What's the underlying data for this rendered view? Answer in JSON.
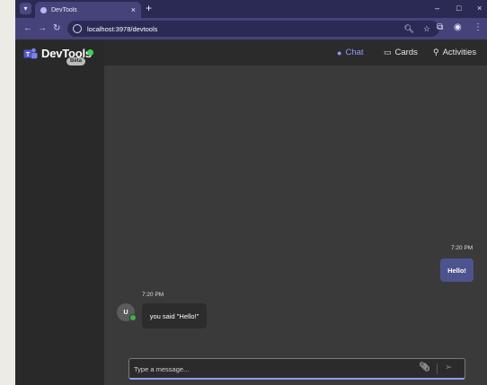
{
  "browser": {
    "tab_title": "DevTools",
    "tab_close": "×",
    "new_tab": "+",
    "url": "localhost:3978/devtools",
    "controls": {
      "minimize": "–",
      "maximize": "□",
      "close": "×"
    }
  },
  "sidebar": {
    "brand": "DevTools",
    "badge": "Beta"
  },
  "nav": {
    "tabs": [
      {
        "label": "Chat",
        "icon": "chat-icon"
      },
      {
        "label": "Cards",
        "icon": "cards-icon"
      },
      {
        "label": "Activities",
        "icon": "search-icon"
      }
    ],
    "active": "Chat"
  },
  "chat": {
    "messages": [
      {
        "from": "user",
        "time": "7:20 PM",
        "text": "Hello!"
      },
      {
        "from": "bot",
        "time": "7:20 PM",
        "text": "you said \"Hello!\"",
        "avatar": "U"
      }
    ]
  },
  "composer": {
    "placeholder": "Type a message..."
  },
  "colors": {
    "chrome": "#2b2a55",
    "accent": "#8f9bff",
    "user_bubble": "#4d538f",
    "online": "#3fd05a"
  }
}
